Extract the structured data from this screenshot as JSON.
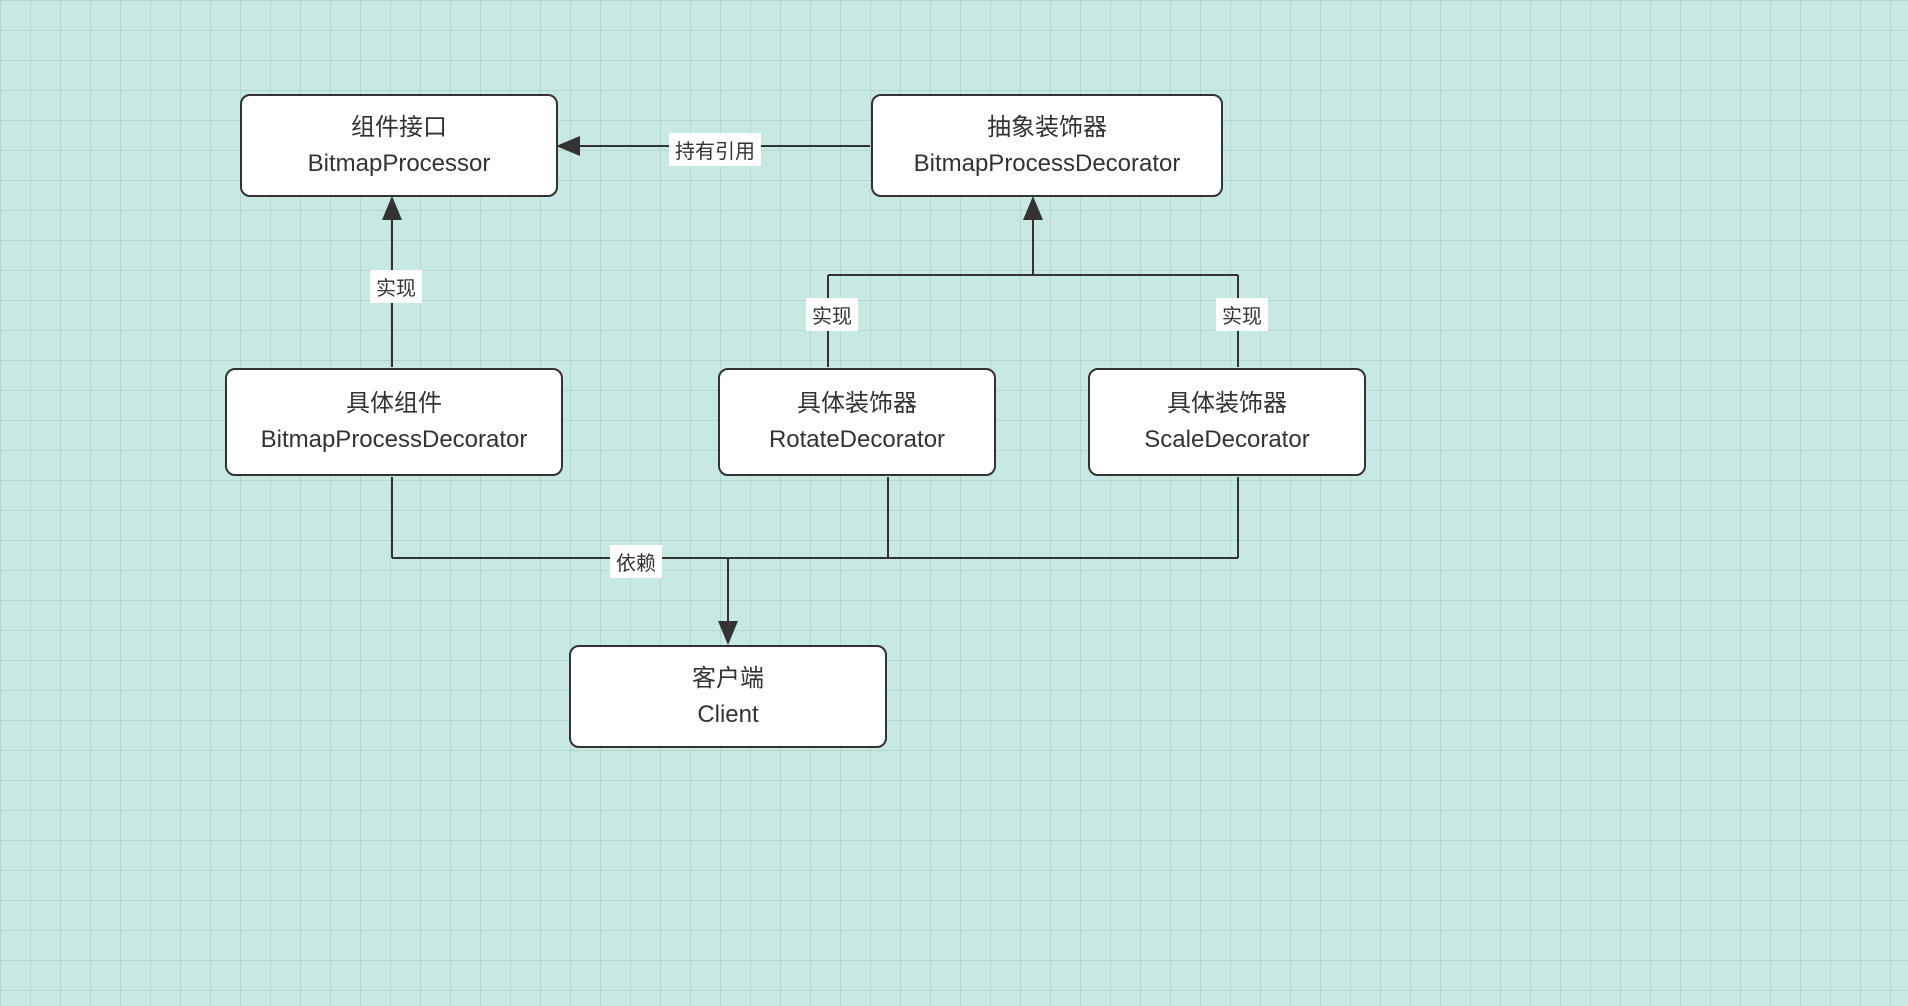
{
  "nodes": {
    "component_interface": {
      "title": "组件接口",
      "subtitle": "BitmapProcessor"
    },
    "abstract_decorator": {
      "title": "抽象装饰器",
      "subtitle": "BitmapProcessDecorator"
    },
    "concrete_component": {
      "title": "具体组件",
      "subtitle": "BitmapProcessDecorator"
    },
    "rotate_decorator": {
      "title": "具体装饰器",
      "subtitle": "RotateDecorator"
    },
    "scale_decorator": {
      "title": "具体装饰器",
      "subtitle": "ScaleDecorator"
    },
    "client": {
      "title": "客户端",
      "subtitle": "Client"
    }
  },
  "edges": {
    "implements1": "实现",
    "implements2": "实现",
    "implements3": "实现",
    "has_reference": "持有引用",
    "depends": "依赖"
  }
}
